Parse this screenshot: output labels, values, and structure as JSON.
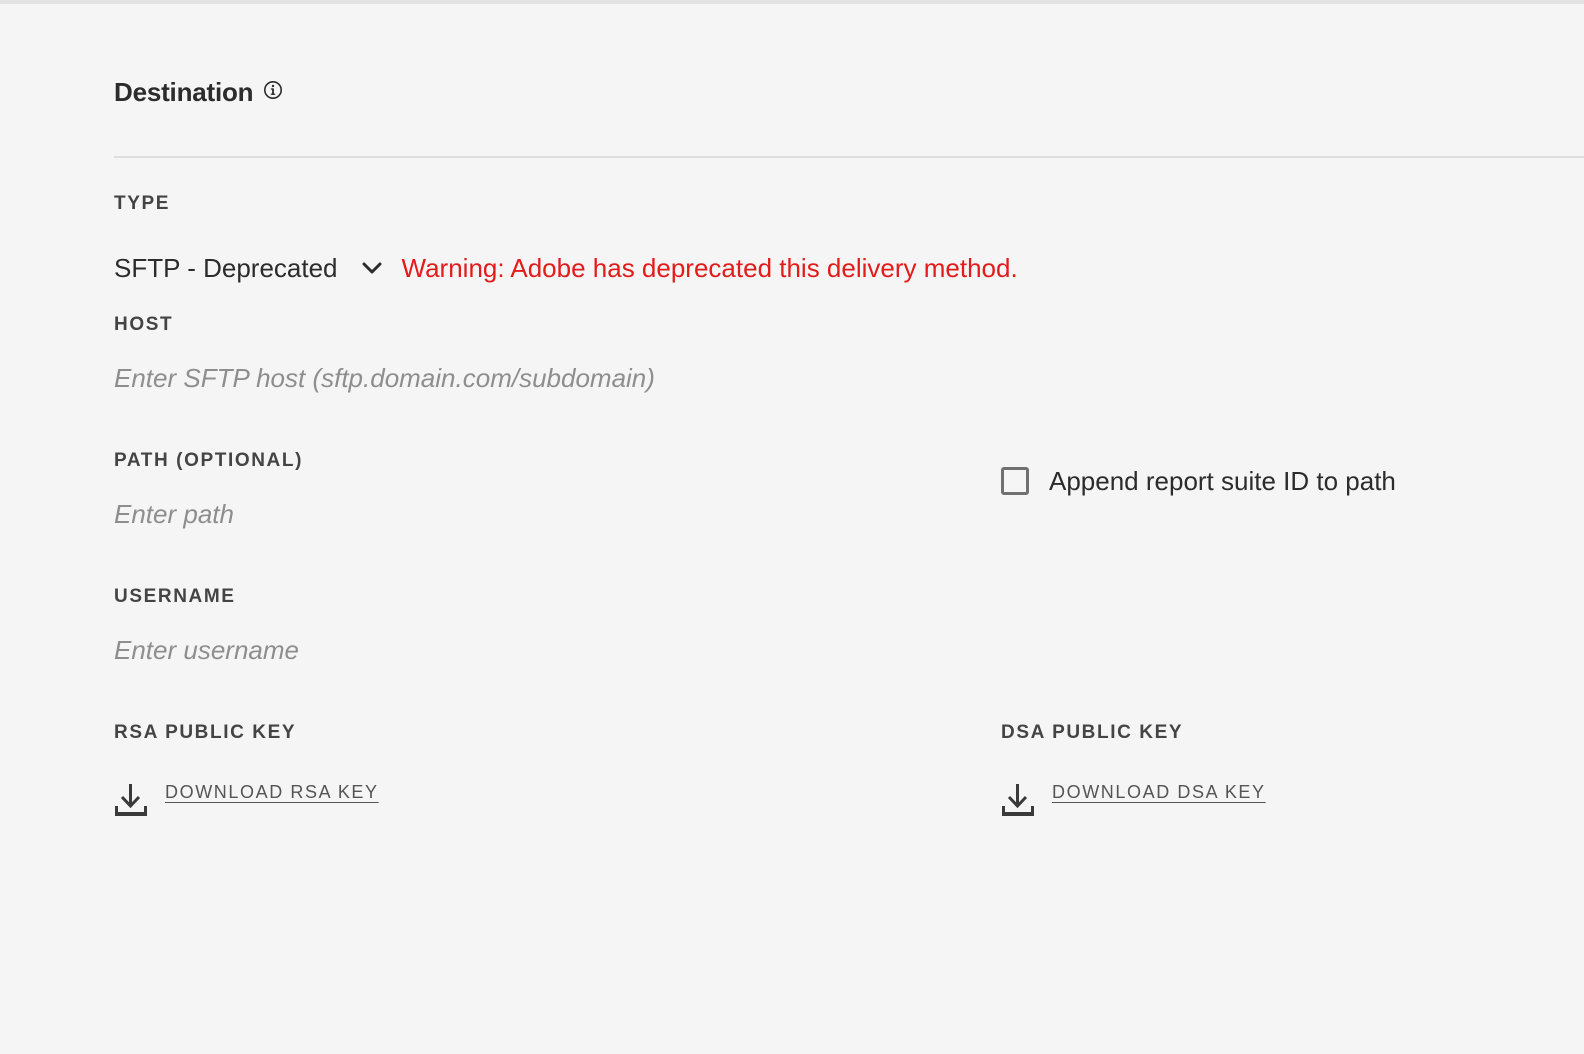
{
  "section": {
    "title": "Destination",
    "info_icon": "info-icon"
  },
  "type_field": {
    "label": "TYPE",
    "value": "SFTP - Deprecated",
    "dropdown_icon": "chevron-down-icon",
    "warning": "Warning: Adobe has deprecated this delivery method."
  },
  "host_field": {
    "label": "HOST",
    "value": "",
    "placeholder": "Enter SFTP host (sftp.domain.com/subdomain)"
  },
  "path_field": {
    "label": "PATH (OPTIONAL)",
    "value": "",
    "placeholder": "Enter path"
  },
  "append_checkbox": {
    "label": "Append report suite ID to path",
    "checked": false
  },
  "username_field": {
    "label": "USERNAME",
    "value": "",
    "placeholder": "Enter username"
  },
  "rsa_key": {
    "label": "RSA PUBLIC KEY",
    "link_label": "DOWNLOAD RSA KEY",
    "icon": "download-icon"
  },
  "dsa_key": {
    "label": "DSA PUBLIC KEY",
    "link_label": "DOWNLOAD DSA KEY",
    "icon": "download-icon"
  },
  "colors": {
    "background": "#f5f5f5",
    "text": "#2c2c2c",
    "label": "#444444",
    "warning": "#e21b1b",
    "placeholder": "#8e8e8e",
    "divider": "#dedede"
  }
}
